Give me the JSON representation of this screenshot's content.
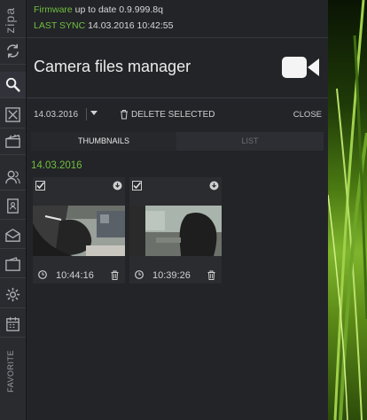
{
  "rail": {
    "brand": "zipa",
    "favorite_label": "FAVORITE"
  },
  "status": {
    "firmware_key": "Firmware",
    "firmware_value": "up to date 0.9.999.8q",
    "sync_key": "LAST SYNC",
    "sync_value": "14.03.2016 10:42:55"
  },
  "header": {
    "title": "Camera files manager"
  },
  "toolbar": {
    "date": "14.03.2016",
    "delete_label": "DELETE SELECTED",
    "close_label": "CLOSE"
  },
  "tabs": {
    "thumbnails": "THUMBNAILS",
    "list": "LIST"
  },
  "gallery": {
    "day_label": "14.03.2016",
    "items": [
      {
        "time": "10:44:16"
      },
      {
        "time": "10:39:26"
      }
    ]
  },
  "colors": {
    "accent_green": "#6fbf3f",
    "panel_bg": "#232428",
    "rail_bg": "#2a2b2f"
  },
  "icons": {
    "rail": [
      "sync-icon",
      "search-icon",
      "expand-icon",
      "clapperboard-icon",
      "users-icon",
      "contacts-icon",
      "mail-icon",
      "wallet-icon",
      "settings-icon",
      "calendar-icon"
    ],
    "header": "video-camera-icon"
  }
}
